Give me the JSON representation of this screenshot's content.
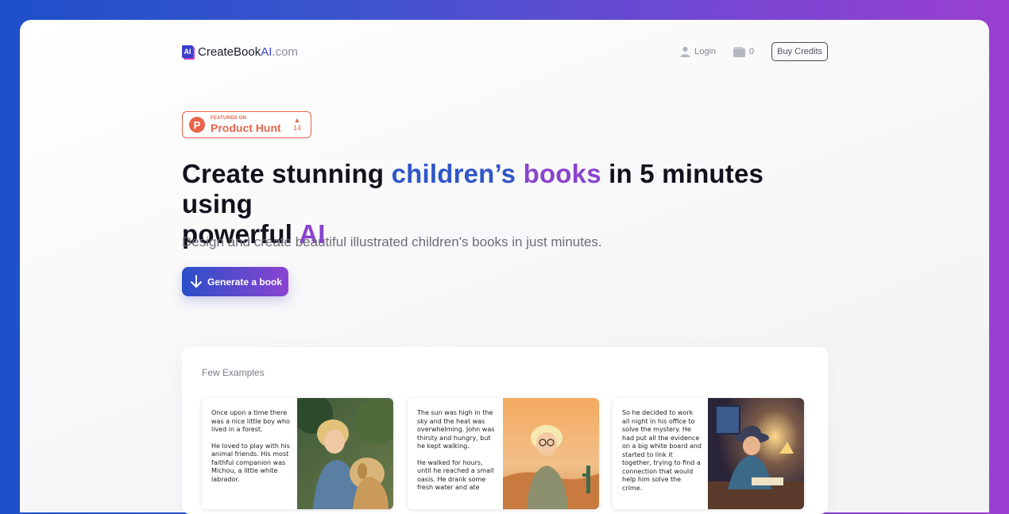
{
  "nav": {
    "logo_mark": "AI",
    "logo_name": "CreateBook",
    "logo_ai": "AI",
    "logo_tld": ".com",
    "login": "Login",
    "cart_count": "0",
    "buy_credits": "Buy Credits"
  },
  "product_hunt": {
    "featured": "FEATURED ON",
    "name": "Product Hunt",
    "votes": "14"
  },
  "hero": {
    "line1_a": "Create stunning ",
    "line1_b": "children’s ",
    "line1_c": "books",
    "line1_d": " in 5 minutes using",
    "line2_a": "powerful ",
    "line2_b": "AI",
    "subtitle": "Design and create beautiful illustrated children's books in just minutes.",
    "cta": "Generate a book"
  },
  "examples": {
    "title": "Few Examples",
    "items": [
      {
        "p1": "Once upon a time there was a nice little boy who lived in a forest.",
        "p2": "He loved to play with his animal friends. His most faithful companion was Michou, a little white labrador."
      },
      {
        "p1": "The sun was high in the sky and the heat was overwhelming. John was thirsty and hungry, but he kept walking.",
        "p2": "He walked for hours, until he reached a small oasis. He drank some fresh water and ate"
      },
      {
        "p1": "So he decided to work all night in his office to solve the mystery. He had put all the evidence on a big white board and started to link it together, trying to find a connection that would help him solve the crime.",
        "p2": ""
      }
    ]
  },
  "colors": {
    "accent_blue": "#2f56c8",
    "accent_purple": "#8a43cf",
    "product_hunt": "#e8644a"
  }
}
